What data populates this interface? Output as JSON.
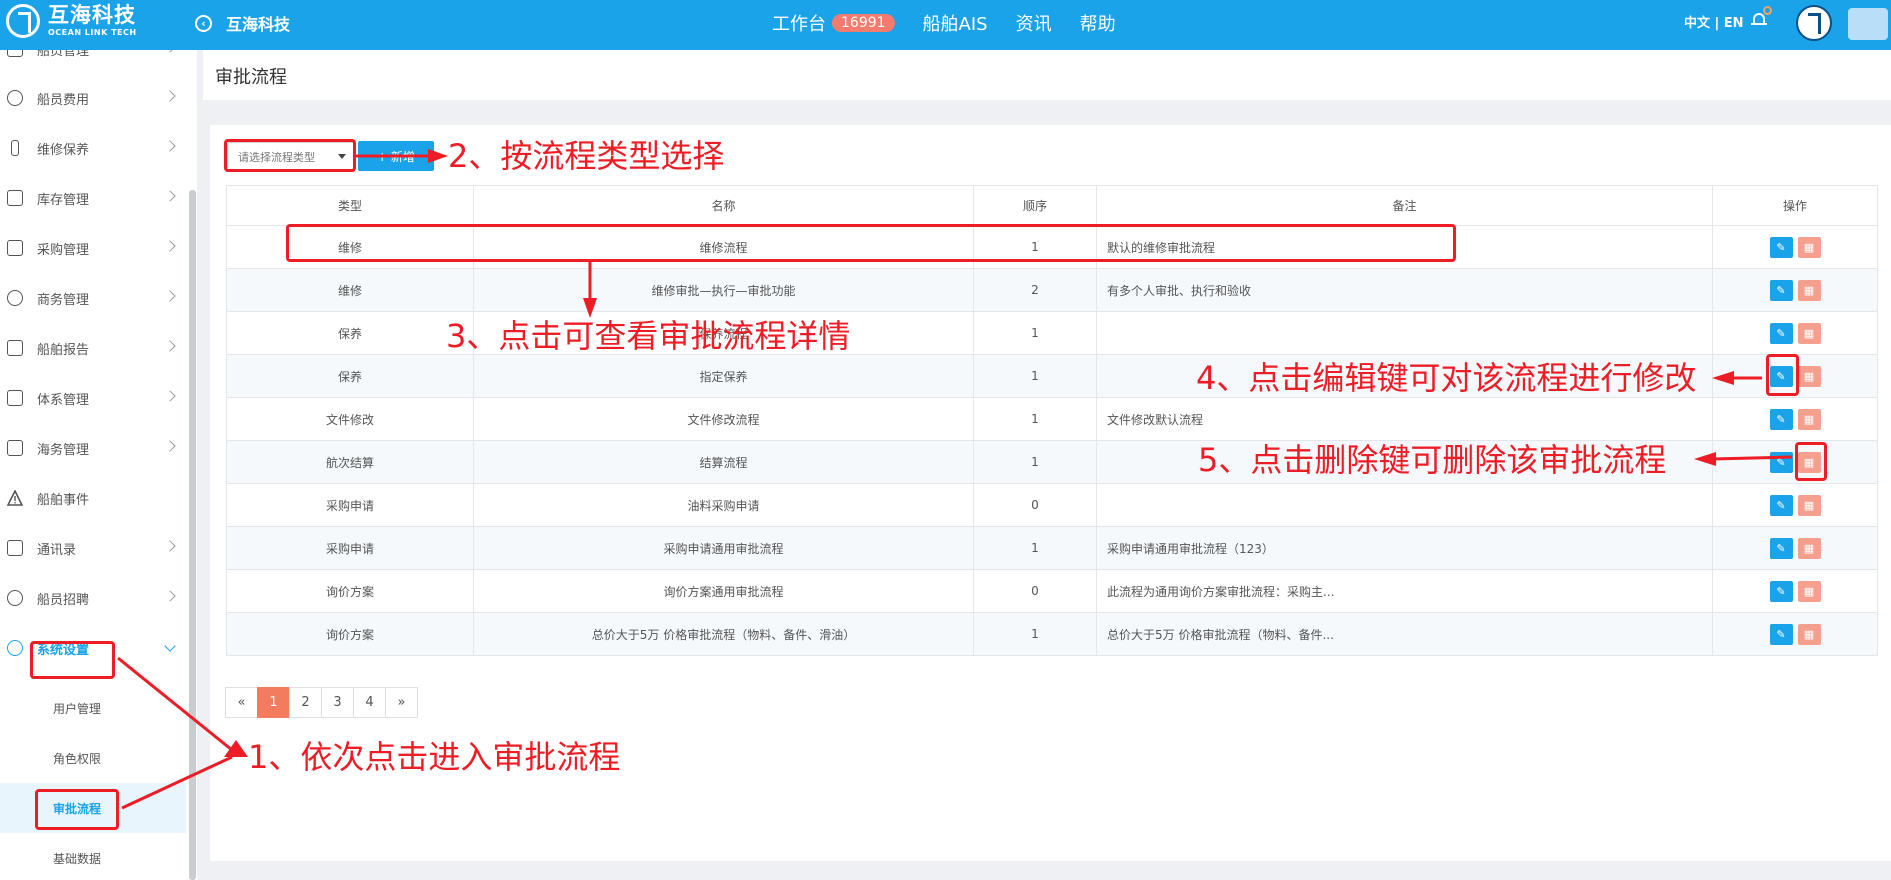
{
  "header": {
    "brand_cn": "互海科技",
    "brand_en": "OCEAN LINK TECH",
    "back_label": "互海科技",
    "nav": [
      {
        "label": "工作台",
        "badge": "16991"
      },
      {
        "label": "船舶AIS"
      },
      {
        "label": "资讯"
      },
      {
        "label": "帮助"
      }
    ],
    "lang": "中文 | EN"
  },
  "sidebar": {
    "items": [
      {
        "label": "船员管理",
        "icon": "user-group-icon"
      },
      {
        "label": "船员费用",
        "icon": "user-icon"
      },
      {
        "label": "维修保养",
        "icon": "wrench-icon"
      },
      {
        "label": "库存管理",
        "icon": "inventory-icon"
      },
      {
        "label": "采购管理",
        "icon": "cart-icon"
      },
      {
        "label": "商务管理",
        "icon": "globe-icon"
      },
      {
        "label": "船舶报告",
        "icon": "calendar-icon"
      },
      {
        "label": "体系管理",
        "icon": "document-icon"
      },
      {
        "label": "海务管理",
        "icon": "signpost-icon"
      },
      {
        "label": "船舶事件",
        "icon": "warning-icon"
      },
      {
        "label": "通讯录",
        "icon": "contacts-icon"
      },
      {
        "label": "船员招聘",
        "icon": "recruit-icon"
      },
      {
        "label": "系统设置",
        "icon": "gear-icon"
      }
    ],
    "sub_items": [
      {
        "label": "用户管理"
      },
      {
        "label": "角色权限"
      },
      {
        "label": "审批流程"
      },
      {
        "label": "基础数据"
      }
    ]
  },
  "page": {
    "title": "审批流程",
    "filter_placeholder": "请选择流程类型",
    "add_label": "+ 新增"
  },
  "table": {
    "headers": [
      "类型",
      "名称",
      "顺序",
      "备注",
      "操作"
    ],
    "rows": [
      {
        "type": "维修",
        "name": "维修流程",
        "order": "1",
        "note": "默认的维修审批流程"
      },
      {
        "type": "维修",
        "name": "维修审批—执行—审批功能",
        "order": "2",
        "note": "有多个人审批、执行和验收"
      },
      {
        "type": "保养",
        "name": "保养流程",
        "order": "1",
        "note": ""
      },
      {
        "type": "保养",
        "name": "指定保养",
        "order": "1",
        "note": ""
      },
      {
        "type": "文件修改",
        "name": "文件修改流程",
        "order": "1",
        "note": "文件修改默认流程"
      },
      {
        "type": "航次结算",
        "name": "结算流程",
        "order": "1",
        "note": ""
      },
      {
        "type": "采购申请",
        "name": "油料采购申请",
        "order": "0",
        "note": ""
      },
      {
        "type": "采购申请",
        "name": "采购申请通用审批流程",
        "order": "1",
        "note": "采购申请通用审批流程（123）"
      },
      {
        "type": "询价方案",
        "name": "询价方案通用审批流程",
        "order": "0",
        "note": "此流程为通用询价方案审批流程：采购主..."
      },
      {
        "type": "询价方案",
        "name": "总价大于5万 价格审批流程（物料、备件、滑油）",
        "order": "1",
        "note": "总价大于5万 价格审批流程（物料、备件..."
      }
    ]
  },
  "pagination": [
    "«",
    "1",
    "2",
    "3",
    "4",
    "»"
  ],
  "annotations": {
    "a1": "1、依次点击进入审批流程",
    "a2": "2、按流程类型选择",
    "a3": "3、点击可查看审批流程详情",
    "a4": "4、点击编辑键可对该流程进行修改",
    "a5": "5、点击删除键可删除该审批流程",
    "color": "#ee1c25"
  },
  "colors": {
    "primary": "#1aa3e8",
    "delete": "#f5a08f",
    "badge": "#f47c6e",
    "page_active": "#f47c5e"
  }
}
